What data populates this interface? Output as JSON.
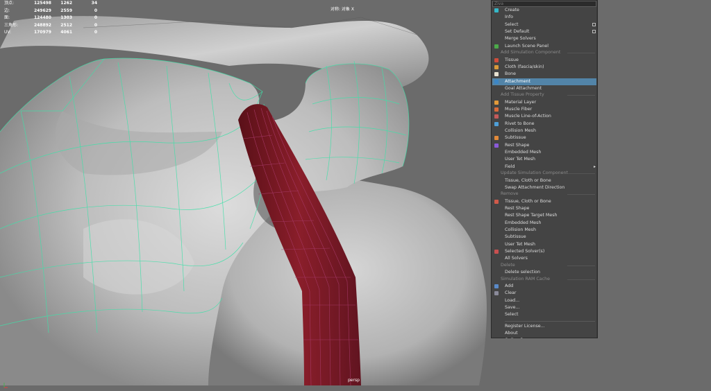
{
  "hud": {
    "rows": [
      {
        "label": "顶点:",
        "c1": "125498",
        "c2": "1262",
        "c3": "34"
      },
      {
        "label": "边:",
        "c1": "249629",
        "c2": "2559",
        "c3": "0"
      },
      {
        "label": "面:",
        "c1": "124480",
        "c2": "1303",
        "c3": "0"
      },
      {
        "label": "三角形:",
        "c1": "248892",
        "c2": "2512",
        "c3": "0"
      },
      {
        "label": "UV:",
        "c1": "170979",
        "c2": "4061",
        "c3": "0"
      }
    ]
  },
  "viewport": {
    "view_label": "对称: 对象 X",
    "camera_label": "persp"
  },
  "menu": {
    "search_placeholder": "Ziva",
    "items": [
      {
        "type": "item",
        "label": "Create",
        "icon_color": "#35b8c8",
        "icon": "ziva-logo-icon"
      },
      {
        "type": "item",
        "label": "Info"
      },
      {
        "type": "item",
        "label": "Select",
        "option_box": true
      },
      {
        "type": "item",
        "label": "Set Default",
        "option_box": true
      },
      {
        "type": "item",
        "label": "Merge Solvers"
      },
      {
        "type": "item",
        "label": "Launch Scene Panel",
        "icon_color": "#4caa4a",
        "icon": "scene-panel-icon"
      },
      {
        "type": "section",
        "label": "Add Simulation Component"
      },
      {
        "type": "item",
        "label": "Tissue",
        "icon_color": "#d04d3a",
        "icon": "tissue-icon"
      },
      {
        "type": "item",
        "label": "Cloth (fascia/skin)",
        "icon_color": "#d89a3a",
        "icon": "cloth-icon"
      },
      {
        "type": "item",
        "label": "Bone",
        "icon_color": "#e6e0d0",
        "icon": "bone-icon"
      },
      {
        "type": "item",
        "label": "Attachment",
        "highlighted": true,
        "icon_color": "#3c86c6",
        "icon": "attachment-icon"
      },
      {
        "type": "item",
        "label": "Goal Attachment"
      },
      {
        "type": "section",
        "label": "Add Tissue Property"
      },
      {
        "type": "item",
        "label": "Material Layer",
        "icon_color": "#e29a3a",
        "icon": "material-layer-icon"
      },
      {
        "type": "item",
        "label": "Muscle Fiber",
        "icon_color": "#d86a3a",
        "icon": "muscle-fiber-icon"
      },
      {
        "type": "item",
        "label": "Muscle Line-of-Action",
        "icon_color": "#c45a5a",
        "icon": "line-of-action-icon"
      },
      {
        "type": "item",
        "label": "Rivet to Bone",
        "icon_color": "#4f9fd8",
        "icon": "rivet-icon"
      },
      {
        "type": "item",
        "label": "Collision Mesh"
      },
      {
        "type": "item",
        "label": "Subtissue",
        "icon_color": "#e28a3a",
        "icon": "subtissue-icon"
      },
      {
        "type": "item",
        "label": "Rest Shape",
        "icon_color": "#8a5ad8",
        "icon": "rest-shape-icon"
      },
      {
        "type": "item",
        "label": "Embedded Mesh"
      },
      {
        "type": "item",
        "label": "User Tet Mesh"
      },
      {
        "type": "item",
        "label": "Field",
        "submenu": true
      },
      {
        "type": "section",
        "label": "Update Simulation Component"
      },
      {
        "type": "item",
        "label": "Tissue, Cloth or Bone"
      },
      {
        "type": "item",
        "label": "Swap Attachment Direction"
      },
      {
        "type": "section",
        "label": "Remove"
      },
      {
        "type": "item",
        "label": "Tissue, Cloth or Bone",
        "icon_color": "#d05a4a",
        "icon": "remove-icon"
      },
      {
        "type": "item",
        "label": "Rest Shape"
      },
      {
        "type": "item",
        "label": "Rest Shape Target Mesh"
      },
      {
        "type": "item",
        "label": "Embedded Mesh"
      },
      {
        "type": "item",
        "label": "Collision Mesh"
      },
      {
        "type": "item",
        "label": "Subtissue"
      },
      {
        "type": "item",
        "label": "User Tet Mesh"
      },
      {
        "type": "item",
        "label": "Selected Solver(s)",
        "icon_color": "#c85050",
        "icon": "solver-icon"
      },
      {
        "type": "item",
        "label": "All Solvers"
      },
      {
        "type": "section",
        "label": "Delete"
      },
      {
        "type": "item",
        "label": "Delete selection"
      },
      {
        "type": "section",
        "label": "Simulation RAM Cache"
      },
      {
        "type": "item",
        "label": "Add",
        "icon_color": "#5a8ac8",
        "icon": "cache-add-icon"
      },
      {
        "type": "item",
        "label": "Clear",
        "icon_color": "#8a8a9a",
        "icon": "cache-clear-icon"
      },
      {
        "type": "item",
        "label": "Load..."
      },
      {
        "type": "item",
        "label": "Save..."
      },
      {
        "type": "item",
        "label": "Select"
      },
      {
        "type": "separator"
      },
      {
        "type": "item",
        "label": "Register License..."
      },
      {
        "type": "item",
        "label": "About"
      },
      {
        "type": "item",
        "label": "Online Resources"
      }
    ]
  }
}
